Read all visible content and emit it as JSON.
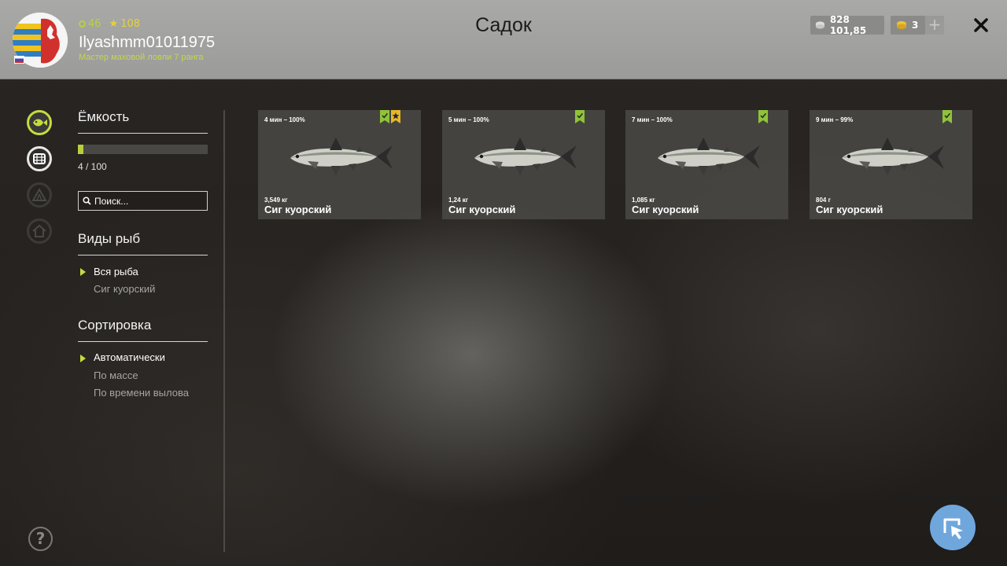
{
  "header": {
    "title": "Садок",
    "level": "46",
    "stars": "108",
    "username": "Ilyashmm01011975",
    "rank": "Мастер маховой ловли 7 ранга",
    "silver": "828 101,85",
    "gold": "3",
    "add_label": "+"
  },
  "sidebar": {
    "capacity_title": "Ёмкость",
    "capacity_used": 4,
    "capacity_max": 100,
    "capacity_text": "4 / 100",
    "search_placeholder": "Поиск...",
    "species_title": "Виды рыб",
    "species": [
      {
        "label": "Вся рыба",
        "selected": true
      },
      {
        "label": "Сиг куорский",
        "selected": false
      }
    ],
    "sort_title": "Сортировка",
    "sort_options": [
      {
        "label": "Автоматически",
        "selected": true
      },
      {
        "label": "По массе",
        "selected": false
      },
      {
        "label": "По времени вылова",
        "selected": false
      }
    ]
  },
  "nav_icons": [
    "fish-icon",
    "keepnet-icon",
    "tent-icon",
    "home-icon"
  ],
  "cards": [
    {
      "time": "4 мин – 100%",
      "weight": "3,549 кг",
      "name": "Сиг куорский",
      "badges": [
        "check",
        "star"
      ]
    },
    {
      "time": "5 мин – 100%",
      "weight": "1,24 кг",
      "name": "Сиг куорский",
      "badges": [
        "check"
      ]
    },
    {
      "time": "7 мин – 100%",
      "weight": "1,085 кг",
      "name": "Сиг куорский",
      "badges": [
        "check"
      ]
    },
    {
      "time": "9 мин – 99%",
      "weight": "804 г",
      "name": "Сиг куорский",
      "badges": [
        "check"
      ]
    }
  ],
  "help_label": "?",
  "colors": {
    "accent": "#b7cf3c",
    "badge_green": "#8fc33a",
    "badge_gold": "#e5b72a",
    "cursor_button": "#6fa7dd"
  }
}
